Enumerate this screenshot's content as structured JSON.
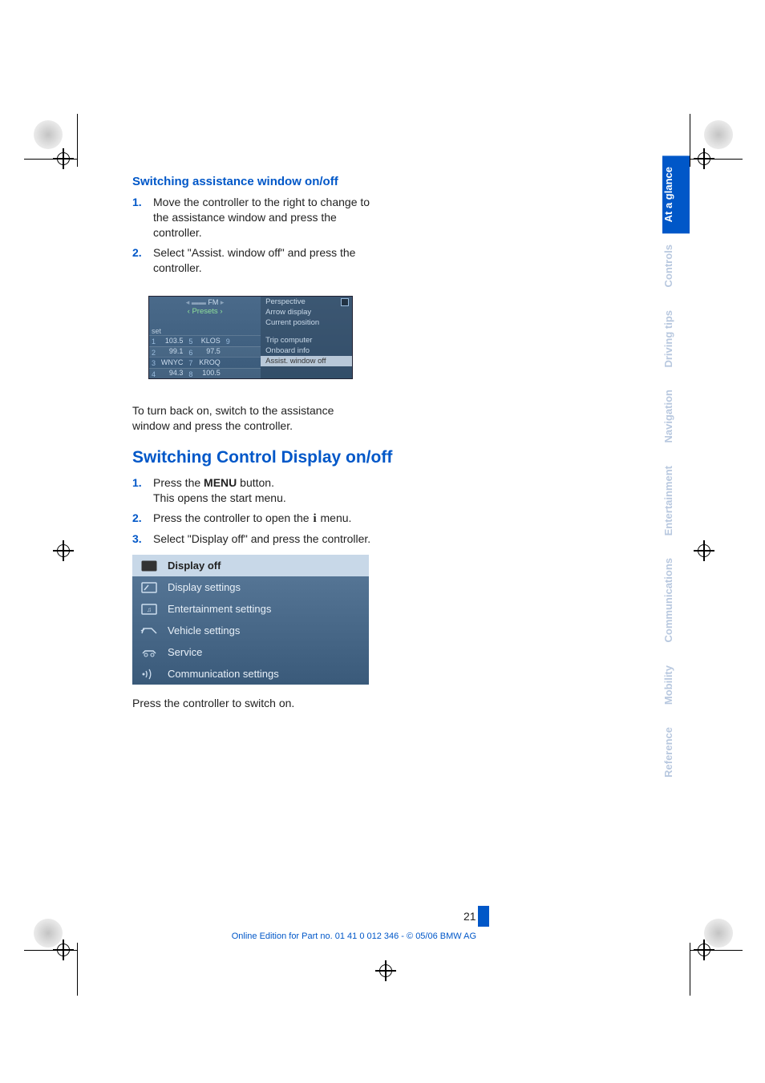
{
  "section1": {
    "heading": "Switching assistance window on/off",
    "steps": [
      "Move the controller to the right to change to the assistance window and press the controller.",
      "Select \"Assist. window off\" and press the controller."
    ],
    "note_after": "To turn back on, switch to the assistance window and press the controller."
  },
  "radioshot": {
    "band": "FM",
    "presets_label": "‹ Presets ›",
    "setlabel": "set",
    "side_items": [
      "Perspective",
      "Arrow display",
      "Current position",
      "Trip computer",
      "Onboard info"
    ],
    "side_hl": "Assist. window off",
    "side_more": "",
    "presets": [
      {
        "n": "1",
        "v": "103.5"
      },
      {
        "n": "5",
        "v": "KLOS"
      },
      {
        "n": "9",
        "v": ""
      },
      {
        "n": "2",
        "v": "99.1"
      },
      {
        "n": "6",
        "v": "97.5"
      },
      {
        "n": "",
        "v": ""
      },
      {
        "n": "3",
        "v": "WNYC"
      },
      {
        "n": "7",
        "v": "KROQ"
      },
      {
        "n": "",
        "v": ""
      },
      {
        "n": "4",
        "v": "94.3"
      },
      {
        "n": "8",
        "v": "100.5"
      },
      {
        "n": "",
        "v": ""
      }
    ]
  },
  "section2": {
    "heading": "Switching Control Display on/off",
    "step1a": "Press the ",
    "step1b": "MENU",
    "step1c": " button.",
    "step1_line2": "This opens the start menu.",
    "step2a": "Press the controller to open the ",
    "step2b": " menu.",
    "step3": "Select \"Display off\" and press the controller.",
    "note_after": "Press the controller to switch on."
  },
  "menushot": {
    "hl": "Display off",
    "items": [
      "Display settings",
      "Entertainment settings",
      "Vehicle settings",
      "Service",
      "Communication settings"
    ]
  },
  "tabs": [
    "At a glance",
    "Controls",
    "Driving tips",
    "Navigation",
    "Entertainment",
    "Communications",
    "Mobility",
    "Reference"
  ],
  "page": "21",
  "footer": "Online Edition for Part no. 01 41 0 012 346 - © 05/06 BMW AG"
}
